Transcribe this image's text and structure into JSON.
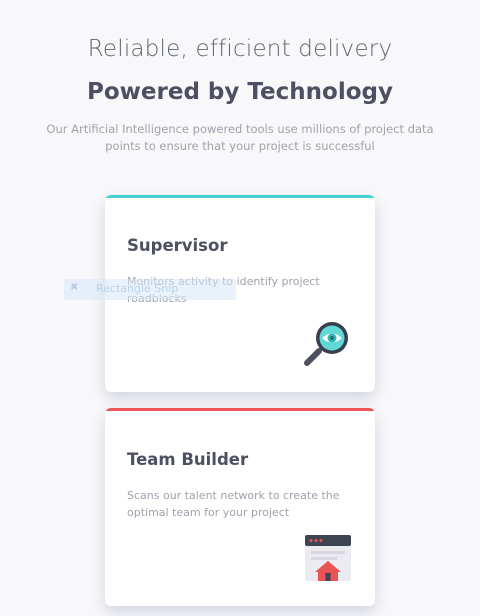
{
  "header": {
    "tagline": "Reliable, efficient delivery",
    "title": "Powered by Technology",
    "intro": "Our Artificial Intelligence powered tools use millions of project data points to ensure that your project is successful"
  },
  "overlay": {
    "label": "Rectangle Snip"
  },
  "cards": [
    {
      "title": "Supervisor",
      "description": "Monitors activity to identify project roadblocks",
      "icon": "magnifier-eye-icon",
      "accent": "#44d3d2"
    },
    {
      "title": "Team Builder",
      "description": "Scans our talent network to create the optimal team for your project",
      "icon": "team-builder-icon",
      "accent": "#ea5454"
    }
  ],
  "colors": {
    "background": "#f8f8fa",
    "heading": "#4d5060",
    "body_text": "#9fa2ad",
    "cyan": "#44d3d2",
    "red": "#ea5454"
  }
}
